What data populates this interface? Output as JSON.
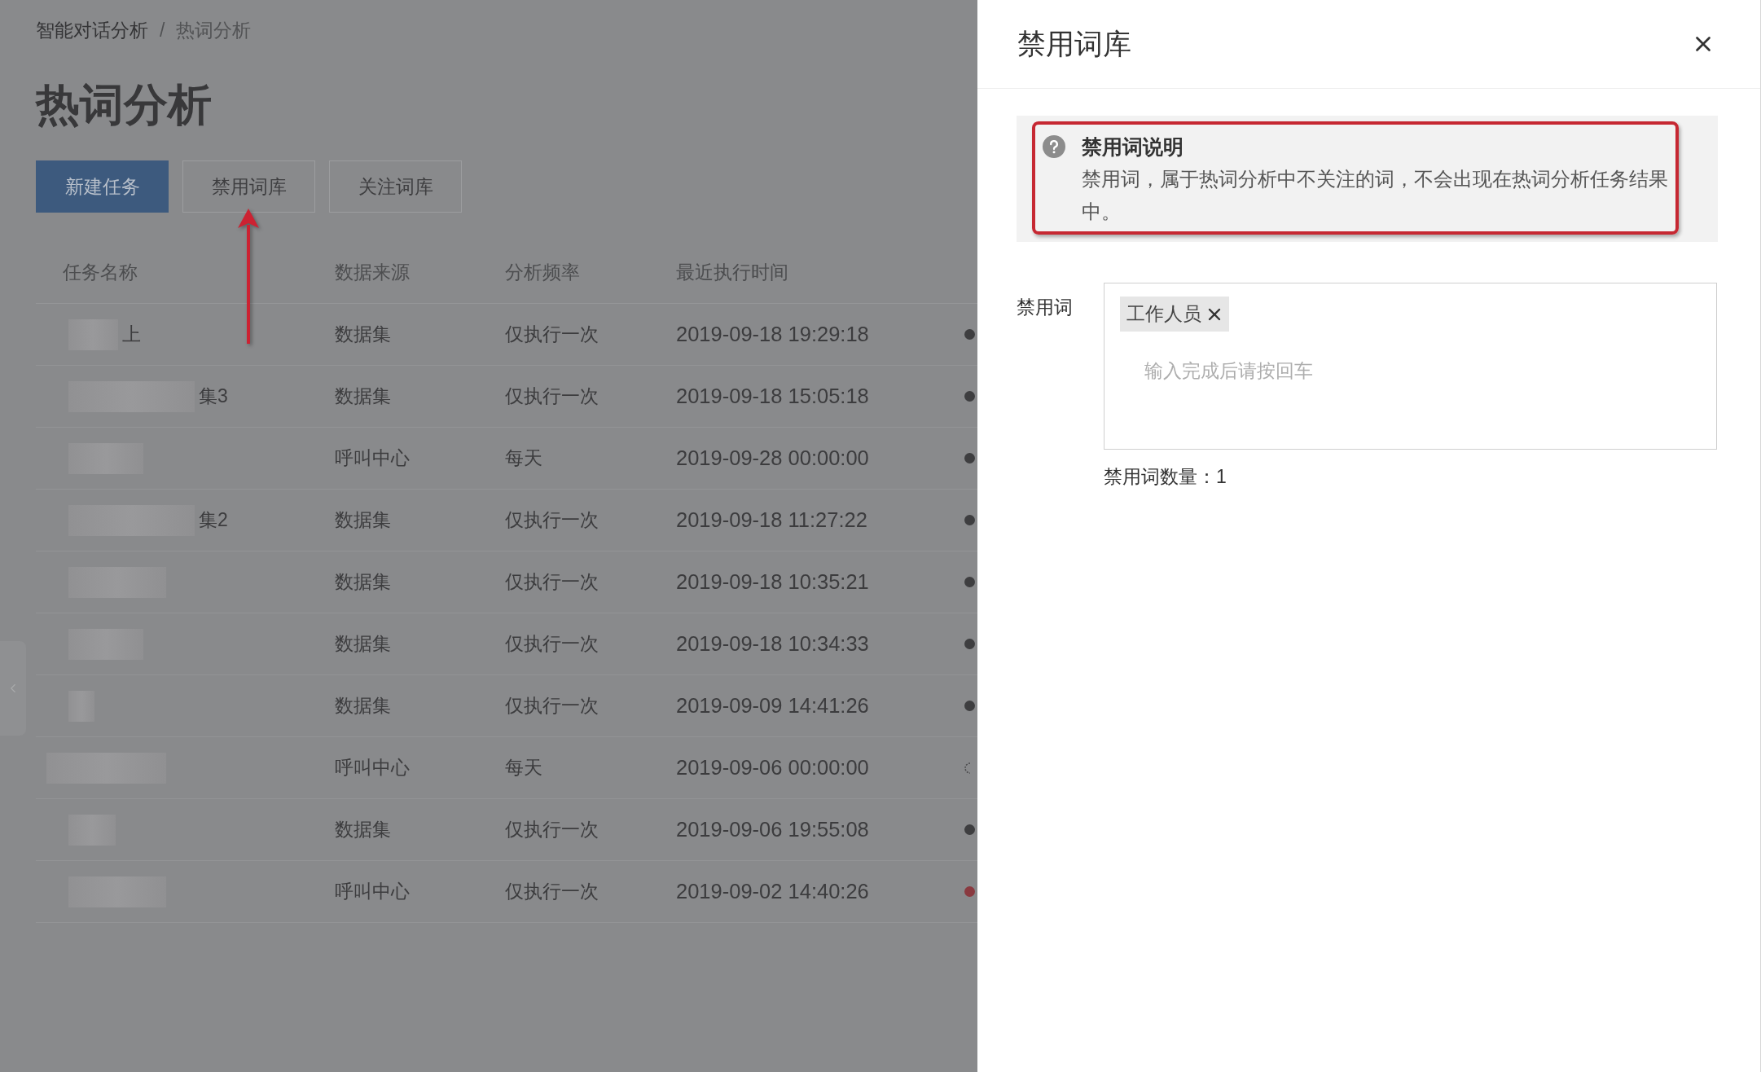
{
  "breadcrumb": {
    "separator": "/",
    "items": [
      {
        "label": "智能对话分析",
        "current": false
      },
      {
        "label": "热词分析",
        "current": true
      }
    ]
  },
  "page": {
    "title": "热词分析"
  },
  "toolbar": [
    {
      "label": "新建任务",
      "kind": "primary"
    },
    {
      "label": "禁用词库",
      "kind": "default"
    },
    {
      "label": "关注词库",
      "kind": "default"
    }
  ],
  "table": {
    "columns": [
      "任务名称",
      "数据来源",
      "分析频率",
      "最近执行时间"
    ],
    "rows": [
      {
        "task_name": "上",
        "data_source": "数据集",
        "frequency": "仅执行一次",
        "last_run": "2019-09-18 19:29:18",
        "status": {
          "kind": "dot",
          "color": "#3e3e40"
        }
      },
      {
        "task_name": "集3",
        "data_source": "数据集",
        "frequency": "仅执行一次",
        "last_run": "2019-09-18 15:05:18",
        "status": {
          "kind": "dot",
          "color": "#3e3e40"
        }
      },
      {
        "data_source": "呼叫中心",
        "frequency": "每天",
        "last_run": "2019-09-28 00:00:00",
        "status": {
          "kind": "dot",
          "color": "#3e3e40"
        }
      },
      {
        "task_name": "集2",
        "data_source": "数据集",
        "frequency": "仅执行一次",
        "last_run": "2019-09-18 11:27:22",
        "status": {
          "kind": "dot",
          "color": "#3e3e40"
        }
      },
      {
        "data_source": "数据集",
        "frequency": "仅执行一次",
        "last_run": "2019-09-18 10:35:21",
        "status": {
          "kind": "dot",
          "color": "#3e3e40"
        }
      },
      {
        "data_source": "数据集",
        "frequency": "仅执行一次",
        "last_run": "2019-09-18 10:34:33",
        "status": {
          "kind": "dot",
          "color": "#3e3e40"
        }
      },
      {
        "data_source": "数据集",
        "frequency": "仅执行一次",
        "last_run": "2019-09-09 14:41:26",
        "status": {
          "kind": "dot",
          "color": "#3e3e40"
        }
      },
      {
        "data_source": "呼叫中心",
        "frequency": "每天",
        "last_run": "2019-09-06 00:00:00",
        "status": {
          "kind": "spinner"
        }
      },
      {
        "data_source": "数据集",
        "frequency": "仅执行一次",
        "last_run": "2019-09-06 19:55:08",
        "status": {
          "kind": "dot",
          "color": "#3e3e40"
        }
      },
      {
        "data_source": "呼叫中心",
        "frequency": "仅执行一次",
        "last_run": "2019-09-02 14:40:26",
        "status": {
          "kind": "dot",
          "color": "#8a3a40"
        }
      }
    ]
  },
  "drawer": {
    "title": "禁用词库",
    "notice": {
      "title": "禁用词说明",
      "text": "禁用词，属于热词分析中不关注的词，不会出现在热词分析任务结果中。"
    },
    "field": {
      "label": "禁用词",
      "tags": [
        "工作人员"
      ],
      "placeholder": "输入完成后请按回车"
    },
    "count": "禁用词数量：1"
  }
}
